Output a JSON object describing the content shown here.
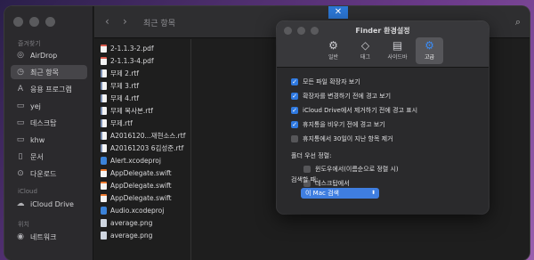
{
  "finder": {
    "toolbar_title": "최근 항목",
    "nav_back": "‹",
    "nav_forward": "›",
    "search_icon": "search-icon",
    "sidebar": {
      "favorites_header": "즐겨찾기",
      "icloud_header": "iCloud",
      "locations_header": "위치",
      "items": [
        {
          "icon": "airdrop-icon",
          "glyph": "◎",
          "label": "AirDrop"
        },
        {
          "icon": "clock-icon",
          "glyph": "◷",
          "label": "최근 항목"
        },
        {
          "icon": "apps-icon",
          "glyph": "A",
          "label": "응용 프로그램"
        },
        {
          "icon": "folder-icon",
          "glyph": "▭",
          "label": "yej"
        },
        {
          "icon": "desktop-icon",
          "glyph": "▭",
          "label": "데스크탑"
        },
        {
          "icon": "folder-icon",
          "glyph": "▭",
          "label": "khw"
        },
        {
          "icon": "document-icon",
          "glyph": "▯",
          "label": "문서"
        },
        {
          "icon": "download-icon",
          "glyph": "⊙",
          "label": "다운로드"
        }
      ],
      "icloud_items": [
        {
          "icon": "cloud-icon",
          "glyph": "☁",
          "label": "iCloud Drive"
        }
      ],
      "location_items": [
        {
          "icon": "network-icon",
          "glyph": "◉",
          "label": "네트워크"
        }
      ]
    },
    "files": [
      {
        "type": "pdf",
        "name": "2-1.1.3-2.pdf"
      },
      {
        "type": "pdf",
        "name": "2-1.1.3-4.pdf"
      },
      {
        "type": "rtf",
        "name": "무제 2.rtf"
      },
      {
        "type": "rtf",
        "name": "무제 3.rtf"
      },
      {
        "type": "rtf",
        "name": "무제 4.rtf"
      },
      {
        "type": "rtf",
        "name": "무제 복사본.rtf"
      },
      {
        "type": "rtf",
        "name": "무제.rtf"
      },
      {
        "type": "rtf",
        "name": "A2016120...재현소스.rtf"
      },
      {
        "type": "rtf",
        "name": "A20161203 6김성준.rtf"
      },
      {
        "type": "xcode",
        "name": "Alert.xcodeproj"
      },
      {
        "type": "swift",
        "name": "AppDelegate.swift"
      },
      {
        "type": "swift",
        "name": "AppDelegate.swift"
      },
      {
        "type": "swift",
        "name": "AppDelegate.swift"
      },
      {
        "type": "xcode",
        "name": "Audio.xcodeproj"
      },
      {
        "type": "png",
        "name": "average.png"
      },
      {
        "type": "png",
        "name": "average.png"
      }
    ]
  },
  "prefs": {
    "title": "Finder 환경설정",
    "tabs": [
      {
        "icon": "gear-icon",
        "glyph": "⚙",
        "label": "일반",
        "active": false
      },
      {
        "icon": "tag-icon",
        "glyph": "◇",
        "label": "태그",
        "active": false
      },
      {
        "icon": "sidebar-icon",
        "glyph": "▤",
        "label": "사이드바",
        "active": false
      },
      {
        "icon": "advanced-gear-icon",
        "glyph": "⚙",
        "label": "고급",
        "active": true
      }
    ],
    "options": [
      {
        "label": "모든 파일 확장자 보기",
        "checked": true
      },
      {
        "label": "확장자를 변경하기 전에 경고 보기",
        "checked": true
      },
      {
        "label": "iCloud Drive에서 제거하기 전에 경고 표시",
        "checked": true
      },
      {
        "label": "휴지통을 비우기 전에 경고 보기",
        "checked": true
      },
      {
        "label": "휴지통에서 30일이 지난 항목 제거",
        "checked": false
      }
    ],
    "folder_section": "폴더 우선 정렬:",
    "folder_options": [
      {
        "label": "윈도우에서(이름순으로 정렬 시)",
        "checked": false
      },
      {
        "label": "데스크탑에서",
        "checked": false
      }
    ],
    "search_section": "검색할 때:",
    "search_value": "이 Mac 검색",
    "accent": "#2f79e0"
  }
}
